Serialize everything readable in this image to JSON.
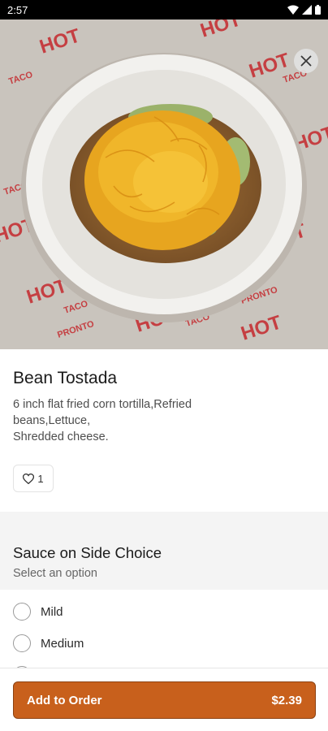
{
  "status_bar": {
    "time": "2:57"
  },
  "item": {
    "name": "Bean Tostada",
    "description": "6 inch flat fried corn tortilla,Refried beans,Lettuce,\nShredded cheese.",
    "likes": "1"
  },
  "paper_print": {
    "hot": "HOT",
    "taco": "TACO",
    "pronto": "PRONTO"
  },
  "option_group": {
    "title": "Sauce on Side Choice",
    "subtitle": "Select an option",
    "options": [
      "Mild",
      "Medium"
    ]
  },
  "order_button": {
    "label": "Add to Order",
    "price": "$2.39"
  },
  "colors": {
    "accent": "#c8601c",
    "print_red": "#c4282c"
  }
}
